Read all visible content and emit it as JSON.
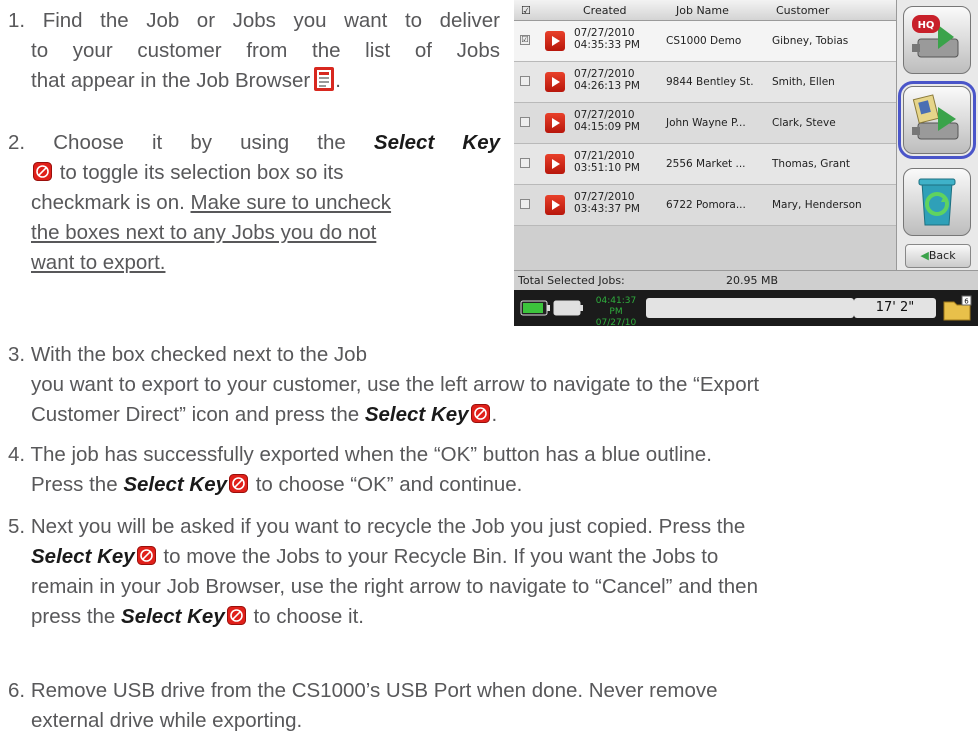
{
  "steps": {
    "s1": {
      "num": "1.",
      "l1": "Find the Job or Jobs you want to deliver",
      "l2": "to your customer from the list of Jobs",
      "l3": "that appear in the Job Browser"
    },
    "s2": {
      "num": "2.",
      "l1a": "Choose it by using the",
      "key": "Select Key",
      "l2": "to toggle its selection box so its",
      "l3a": "checkmark is on.",
      "l3b": "Make sure to uncheck",
      "l4": "the boxes next to any Jobs you do not",
      "l5": "want to export."
    },
    "s3": {
      "num": "3.",
      "l1": "With the box checked next to the Job",
      "l2": "you want to export to your customer, use the left arrow to navigate to the “Export",
      "l3a": "Customer Direct” icon and press the",
      "key": "Select Key"
    },
    "s4": {
      "num": "4.",
      "l1": "The job has successfully exported when the “OK” button has a blue outline.",
      "l2a": "Press the",
      "key": "Select Key",
      "l2b": "to choose “OK” and continue."
    },
    "s5": {
      "num": "5.",
      "l1": "Next you will be asked if you want to recycle the Job you just copied. Press the",
      "key": "Select Key",
      "l2b": "to move the Jobs to your Recycle Bin. If you want the Jobs to",
      "l3": "remain in your Job Browser, use the right arrow to navigate to “Cancel” and then",
      "l4a": "press the",
      "l4b": "to choose it."
    },
    "s6": {
      "num": "6.",
      "l1": "Remove USB drive from the CS1000’s USB Port when done. Never remove",
      "l2": "external drive while exporting."
    }
  },
  "device": {
    "headers": {
      "check": "☑",
      "created": "Created",
      "job_name": "Job Name",
      "customer": "Customer"
    },
    "rows": [
      {
        "checked": "☑",
        "date": "07/27/2010",
        "time": "04:35:33 PM",
        "job": "CS1000 Demo",
        "customer": "Gibney, Tobias"
      },
      {
        "checked": "",
        "date": "07/27/2010",
        "time": "04:26:13 PM",
        "job": "9844 Bentley St.",
        "customer": "Smith, Ellen"
      },
      {
        "checked": "",
        "date": "07/27/2010",
        "time": "04:15:09 PM",
        "job": "John Wayne P...",
        "customer": "Clark, Steve"
      },
      {
        "checked": "",
        "date": "07/21/2010",
        "time": "03:51:10 PM",
        "job": "2556 Market ...",
        "customer": "Thomas, Grant"
      },
      {
        "checked": "",
        "date": "07/27/2010",
        "time": "03:43:37 PM",
        "job": "6722 Pomora...",
        "customer": "Mary, Henderson"
      }
    ],
    "total_label": "Total Selected Jobs:",
    "total_size": "20.95 MB",
    "back_label": "Back",
    "clock_time": "04:41:37 PM",
    "clock_date": "07/27/10",
    "distance": "17' 2\"",
    "hq_label": "HQ",
    "folder_badge": "6"
  },
  "colors": {
    "text": "#58585a",
    "key_red": "#e0201a",
    "highlight": "#4a55c9"
  }
}
